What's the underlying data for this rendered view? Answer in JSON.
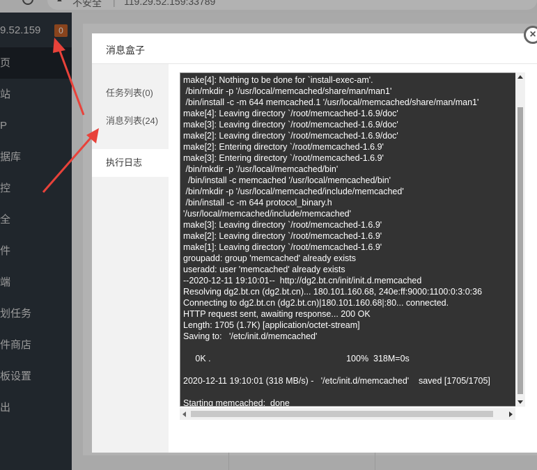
{
  "browser": {
    "security_label": "不安全",
    "separator": "|",
    "url": "119.29.52.159:33789"
  },
  "sidebar": {
    "ip": "9.52.159",
    "badge": "0",
    "items": [
      {
        "label": "页"
      },
      {
        "label": "站"
      },
      {
        "label": "P"
      },
      {
        "label": "据库"
      },
      {
        "label": "控"
      },
      {
        "label": "全"
      },
      {
        "label": "件"
      },
      {
        "label": "端"
      },
      {
        "label": "划任务"
      },
      {
        "label": "件商店"
      },
      {
        "label": "板设置"
      },
      {
        "label": "出"
      }
    ]
  },
  "modal": {
    "title": "消息盒子",
    "close_icon": "×",
    "tabs": [
      {
        "label": "任务列表(0)"
      },
      {
        "label": "消息列表(24)"
      },
      {
        "label": "执行日志"
      }
    ],
    "active_tab": 2,
    "log_lines": [
      "make[4]: Nothing to be done for `install-exec-am'.",
      " /bin/mkdir -p '/usr/local/memcached/share/man/man1'",
      " /bin/install -c -m 644 memcached.1 '/usr/local/memcached/share/man/man1'",
      "make[4]: Leaving directory `/root/memcached-1.6.9/doc'",
      "make[3]: Leaving directory `/root/memcached-1.6.9/doc'",
      "make[2]: Leaving directory `/root/memcached-1.6.9/doc'",
      "make[2]: Entering directory `/root/memcached-1.6.9'",
      "make[3]: Entering directory `/root/memcached-1.6.9'",
      " /bin/mkdir -p '/usr/local/memcached/bin'",
      "  /bin/install -c memcached '/usr/local/memcached/bin'",
      " /bin/mkdir -p '/usr/local/memcached/include/memcached'",
      " /bin/install -c -m 644 protocol_binary.h",
      "'/usr/local/memcached/include/memcached'",
      "make[3]: Leaving directory `/root/memcached-1.6.9'",
      "make[2]: Leaving directory `/root/memcached-1.6.9'",
      "make[1]: Leaving directory `/root/memcached-1.6.9'",
      "groupadd: group 'memcached' already exists",
      "useradd: user 'memcached' already exists",
      "--2020-12-11 19:10:01--  http://dg2.bt.cn/init/init.d.memcached",
      "Resolving dg2.bt.cn (dg2.bt.cn)... 180.101.160.68, 240e:ff:9000:1100:0:3:0:36",
      "Connecting to dg2.bt.cn (dg2.bt.cn)|180.101.160.68|:80... connected.",
      "HTTP request sent, awaiting response... 200 OK",
      "Length: 1705 (1.7K) [application/octet-stream]",
      "Saving to:   '/etc/init.d/memcached'",
      "",
      "     0K .                                                        100%  318M=0s",
      "",
      "2020-12-11 19:10:01 (318 MB/s) -   '/etc/init.d/memcached'    saved [1705/1705]",
      "",
      "Starting memcached:  done"
    ]
  },
  "colors": {
    "sidebar_bg": "#2f3740",
    "badge": "#c5622a",
    "terminal_bg": "#333333",
    "arrow": "#e8423a"
  }
}
